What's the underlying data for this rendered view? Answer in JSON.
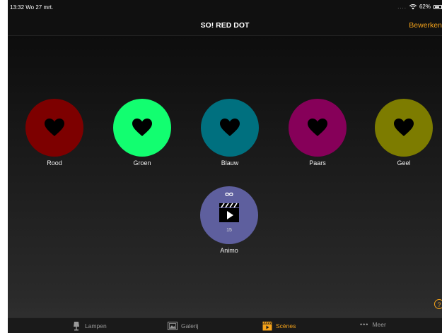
{
  "status": {
    "time": "13:32",
    "date": "Wo 27 mrt.",
    "signal": "....",
    "battery": "62%"
  },
  "nav": {
    "title": "SO! RED DOT",
    "edit_label": "Bewerken"
  },
  "scenes": [
    {
      "label": "Rood",
      "color": "#7d0000"
    },
    {
      "label": "Groen",
      "color": "#12fe70"
    },
    {
      "label": "Blauw",
      "color": "#00707f"
    },
    {
      "label": "Paars",
      "color": "#860059"
    },
    {
      "label": "Geel",
      "color": "#7d7c00"
    }
  ],
  "animo": {
    "label": "Animo",
    "count": "15",
    "color": "#5e5f9e"
  },
  "help": {
    "label": "?"
  },
  "tabs": [
    {
      "label": "Lampen",
      "icon": "lamp-icon",
      "active": false
    },
    {
      "label": "Galerij",
      "icon": "gallery-icon",
      "active": false
    },
    {
      "label": "Scènes",
      "icon": "clapper-icon",
      "active": true
    },
    {
      "label": "Meer",
      "icon": "more-icon",
      "active": false
    }
  ],
  "colors": {
    "accent": "#f5a31a",
    "background_top": "#0d0d0d",
    "background_bottom": "#323232"
  }
}
